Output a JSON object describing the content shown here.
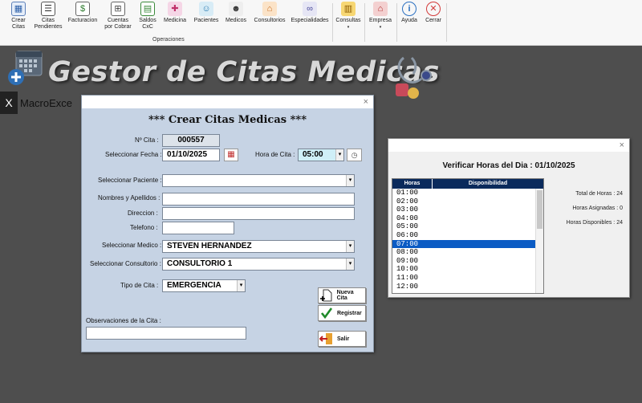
{
  "ribbon": {
    "buttons": [
      {
        "label": "Crear\nCitas",
        "icon": "calendar-add-icon"
      },
      {
        "label": "Citas\nPendientes",
        "icon": "pending-list-icon"
      },
      {
        "label": "Facturacion",
        "icon": "invoice-icon"
      },
      {
        "label": "Cuentas\npor Cobrar",
        "icon": "receivables-icon"
      },
      {
        "label": "Saldos\nCxC",
        "icon": "balances-icon"
      },
      {
        "label": "Medicina",
        "icon": "medicine-icon"
      },
      {
        "label": "Pacientes",
        "icon": "patients-icon"
      },
      {
        "label": "Medicos",
        "icon": "doctors-icon"
      },
      {
        "label": "Consultorios",
        "icon": "offices-icon"
      },
      {
        "label": "Especialidades",
        "icon": "stethoscope-icon"
      },
      {
        "label": "Consultas",
        "icon": "queries-icon"
      },
      {
        "label": "Empresa",
        "icon": "company-icon"
      },
      {
        "label": "Ayuda",
        "icon": "info-icon"
      },
      {
        "label": "Cerrar",
        "icon": "close-circle-icon"
      }
    ],
    "group_label": "Operaciones"
  },
  "background": {
    "title": "Gestor de Citas Medicas",
    "brand": "MacroExce"
  },
  "form_main": {
    "close": "×",
    "title": "*** Crear Citas Medicas ***",
    "cita_label": "Nº Cita :",
    "cita_value": "000557",
    "fecha_label": "Seleccionar Fecha :",
    "fecha_value": "01/10/2025",
    "hora_label": "Hora de Cita :",
    "hora_value": "05:00",
    "paciente_label": "Seleccionar Paciente :",
    "paciente_value": "",
    "nombres_label": "Nombres y Apellidos :",
    "nombres_value": "",
    "direccion_label": "Direccion :",
    "direccion_value": "",
    "telefono_label": "Telefono :",
    "telefono_value": "",
    "medico_label": "Seleccionar Medico :",
    "medico_value": "STEVEN HERNANDEZ",
    "consultorio_label": "Seleccionar Consultorio :",
    "consultorio_value": "CONSULTORIO 1",
    "tipo_label": "Tipo de Cita :",
    "tipo_value": "EMERGENCIA",
    "obs_label": "Observaciones de la Cita :",
    "obs_value": "",
    "btn_nueva": "Nueva Cita",
    "btn_registrar": "Registrar",
    "btn_salir": "Salir"
  },
  "form_verify": {
    "close": "×",
    "title": "Verificar Horas del Dia : 01/10/2025",
    "col_horas": "Horas",
    "col_disponibilidad": "Disponibilidad",
    "hours": [
      "01:00",
      "02:00",
      "03:00",
      "04:00",
      "05:00",
      "06:00",
      "07:00",
      "08:00",
      "09:00",
      "10:00",
      "11:00",
      "12:00"
    ],
    "selected_hour": "07:00",
    "total_horas": "Total de Horas : 24",
    "horas_asignadas": "Horas Asignadas : 0",
    "horas_disponibles": "Horas Disponibles : 24"
  },
  "colors": {
    "form_bg": "#c6d3e4",
    "header_navy": "#0a2a5c",
    "selection_blue": "#0a5bc4"
  }
}
